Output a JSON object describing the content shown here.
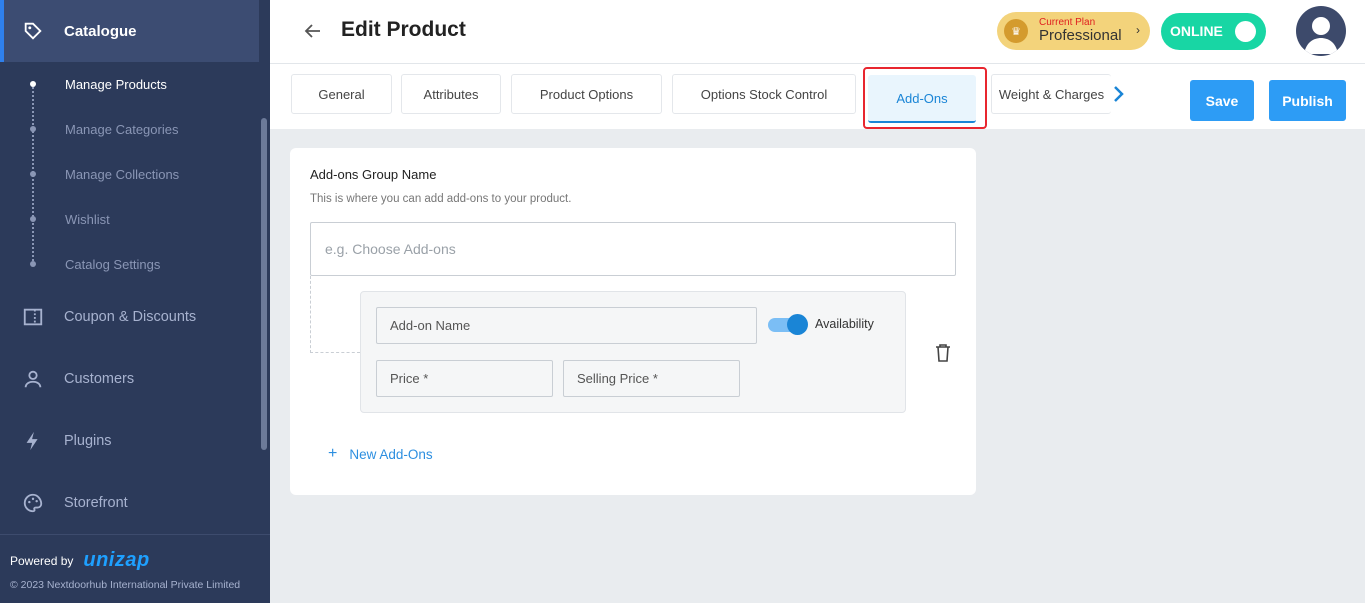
{
  "sidebar": {
    "section_title": "Catalogue",
    "sub_items": [
      {
        "label": "Manage Products",
        "active": true
      },
      {
        "label": "Manage Categories",
        "active": false
      },
      {
        "label": "Manage Collections",
        "active": false
      },
      {
        "label": "Wishlist",
        "active": false
      },
      {
        "label": "Catalog Settings",
        "active": false
      }
    ],
    "nav_items": [
      {
        "label": "Coupon & Discounts",
        "icon": "coupon-icon"
      },
      {
        "label": "Customers",
        "icon": "user-icon"
      },
      {
        "label": "Plugins",
        "icon": "bolt-icon"
      },
      {
        "label": "Storefront",
        "icon": "palette-icon"
      }
    ],
    "powered_by": "Powered by",
    "brand_logo": "unizap",
    "copyright": "© 2023 Nextdoorhub International Private Limited"
  },
  "header": {
    "title": "Edit Product",
    "plan_label": "Current Plan",
    "plan_name": "Professional",
    "status": "ONLINE"
  },
  "tabs": [
    {
      "label": "General",
      "active": false
    },
    {
      "label": "Attributes",
      "active": false
    },
    {
      "label": "Product Options",
      "active": false
    },
    {
      "label": "Options Stock Control",
      "active": false
    },
    {
      "label": "Add-Ons",
      "active": true
    },
    {
      "label": "Weight & Charges",
      "active": false
    }
  ],
  "actions": {
    "save": "Save",
    "publish": "Publish"
  },
  "addons": {
    "group_title": "Add-ons Group Name",
    "group_subtitle": "This is where you can add add-ons to your product.",
    "group_placeholder": "e.g. Choose Add-ons",
    "item": {
      "name_placeholder": "Add-on Name",
      "availability_label": "Availability",
      "availability_on": true,
      "price_placeholder": "Price *",
      "selling_price_placeholder": "Selling Price *"
    },
    "new_button": "New Add-Ons"
  },
  "colors": {
    "sidebar_bg": "#2c3a5a",
    "accent": "#2d9cf5",
    "online": "#18d6a4",
    "plan": "#f3d37b",
    "highlight": "#e8262f"
  }
}
